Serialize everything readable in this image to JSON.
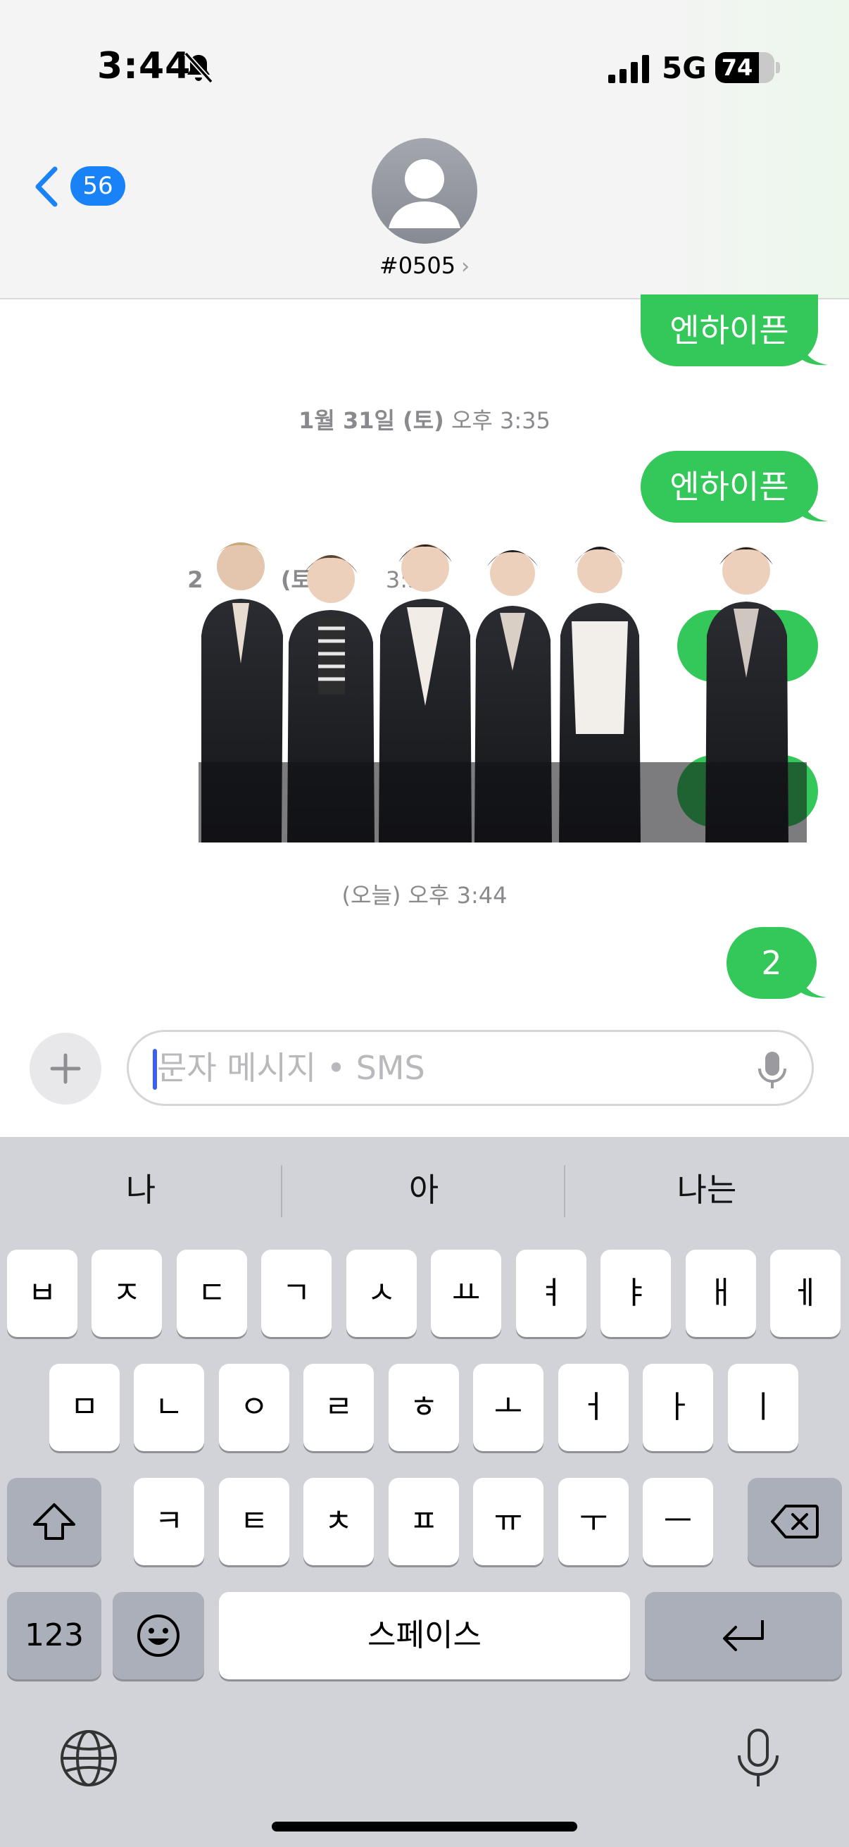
{
  "status_bar": {
    "time": "3:44",
    "muted_icon": "bell-slash-icon",
    "network": "5G",
    "battery": "74",
    "battery_level": 0.74
  },
  "header": {
    "back_badge": "56",
    "contact_name": "#0505",
    "chevron": "›"
  },
  "messages": {
    "top_partial_bubble": "엔하이픈",
    "timestamp_1_date": "1월 31일 (토)",
    "timestamp_1_time": "오후 3:35",
    "bubble_2": "엔하이픈",
    "timestamp_2_date": "2",
    "timestamp_2_mid": "(토)",
    "timestamp_2_time": "3:35",
    "timestamp_3_date": "(오늘)",
    "timestamp_3_time": "오후 3:44",
    "bubble_last": "2",
    "bubble_color": "#34c759"
  },
  "input": {
    "placeholder": "문자 메시지 • SMS"
  },
  "keyboard": {
    "suggestions": [
      "나",
      "아",
      "나는"
    ],
    "row1": [
      "ㅂ",
      "ㅈ",
      "ㄷ",
      "ㄱ",
      "ㅅ",
      "ㅛ",
      "ㅕ",
      "ㅑ",
      "ㅐ",
      "ㅔ"
    ],
    "row2": [
      "ㅁ",
      "ㄴ",
      "ㅇ",
      "ㄹ",
      "ㅎ",
      "ㅗ",
      "ㅓ",
      "ㅏ",
      "ㅣ"
    ],
    "row3": [
      "ㅋ",
      "ㅌ",
      "ㅊ",
      "ㅍ",
      "ㅠ",
      "ㅜ",
      "ㅡ"
    ],
    "numbers_key": "123",
    "space_key": "스페이스"
  }
}
